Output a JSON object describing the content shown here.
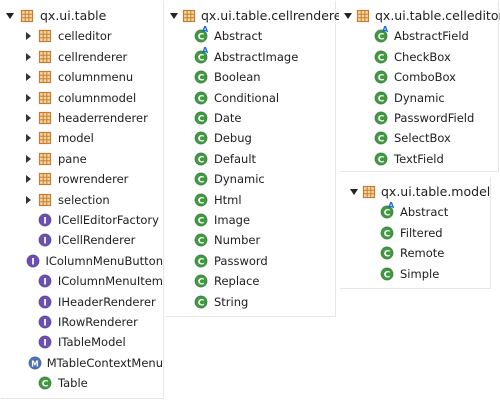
{
  "panels": [
    {
      "header": "qx.ui.table",
      "items": [
        {
          "label": "celleditor",
          "icon": "package-icon",
          "expandable": true
        },
        {
          "label": "cellrenderer",
          "icon": "package-icon",
          "expandable": true
        },
        {
          "label": "columnmenu",
          "icon": "package-icon",
          "expandable": true
        },
        {
          "label": "columnmodel",
          "icon": "package-icon",
          "expandable": true
        },
        {
          "label": "headerrenderer",
          "icon": "package-icon",
          "expandable": true
        },
        {
          "label": "model",
          "icon": "package-icon",
          "expandable": true
        },
        {
          "label": "pane",
          "icon": "package-icon",
          "expandable": true
        },
        {
          "label": "rowrenderer",
          "icon": "package-icon",
          "expandable": true
        },
        {
          "label": "selection",
          "icon": "package-icon",
          "expandable": true
        },
        {
          "label": "ICellEditorFactory",
          "icon": "interface-icon"
        },
        {
          "label": "ICellRenderer",
          "icon": "interface-icon"
        },
        {
          "label": "IColumnMenuButton",
          "icon": "interface-icon"
        },
        {
          "label": "IColumnMenuItem",
          "icon": "interface-icon"
        },
        {
          "label": "IHeaderRenderer",
          "icon": "interface-icon"
        },
        {
          "label": "IRowRenderer",
          "icon": "interface-icon"
        },
        {
          "label": "ITableModel",
          "icon": "interface-icon"
        },
        {
          "label": "MTableContextMenu",
          "icon": "mixin-icon"
        },
        {
          "label": "Table",
          "icon": "class-icon"
        }
      ]
    },
    {
      "header": "qx.ui.table.cellrenderer",
      "items": [
        {
          "label": "Abstract",
          "icon": "abstract-class-icon"
        },
        {
          "label": "AbstractImage",
          "icon": "abstract-class-icon"
        },
        {
          "label": "Boolean",
          "icon": "class-icon"
        },
        {
          "label": "Conditional",
          "icon": "class-icon"
        },
        {
          "label": "Date",
          "icon": "class-icon"
        },
        {
          "label": "Debug",
          "icon": "class-icon"
        },
        {
          "label": "Default",
          "icon": "class-icon"
        },
        {
          "label": "Dynamic",
          "icon": "class-icon"
        },
        {
          "label": "Html",
          "icon": "class-icon"
        },
        {
          "label": "Image",
          "icon": "class-icon"
        },
        {
          "label": "Number",
          "icon": "class-icon"
        },
        {
          "label": "Password",
          "icon": "class-icon"
        },
        {
          "label": "Replace",
          "icon": "class-icon"
        },
        {
          "label": "String",
          "icon": "class-icon"
        }
      ]
    },
    {
      "header": "qx.ui.table.celleditor",
      "items": [
        {
          "label": "AbstractField",
          "icon": "abstract-class-icon"
        },
        {
          "label": "CheckBox",
          "icon": "class-icon"
        },
        {
          "label": "ComboBox",
          "icon": "class-icon"
        },
        {
          "label": "Dynamic",
          "icon": "class-icon"
        },
        {
          "label": "PasswordField",
          "icon": "class-icon"
        },
        {
          "label": "SelectBox",
          "icon": "class-icon"
        },
        {
          "label": "TextField",
          "icon": "class-icon"
        }
      ]
    },
    {
      "header": "qx.ui.table.model",
      "items": [
        {
          "label": "Abstract",
          "icon": "abstract-class-icon"
        },
        {
          "label": "Filtered",
          "icon": "class-icon"
        },
        {
          "label": "Remote",
          "icon": "class-icon"
        },
        {
          "label": "Simple",
          "icon": "class-icon"
        }
      ]
    }
  ],
  "colors": {
    "package": "#c87d2e",
    "interface": "#6b4fb3",
    "mixin": "#4a73b8",
    "class": "#3f9a3f",
    "abstract_mark": "#1e6bd6"
  }
}
